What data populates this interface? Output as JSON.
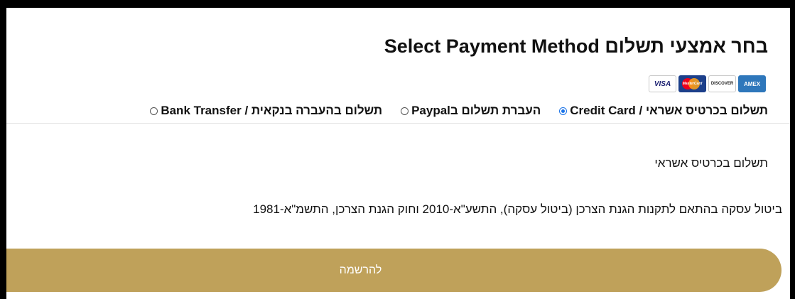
{
  "title": "בחר אמצעי תשלום Select Payment Method",
  "card_logos": [
    {
      "label": "VISA",
      "icon": "visa-logo"
    },
    {
      "label": "MasterCard",
      "icon": "mastercard-logo"
    },
    {
      "label": "DISCOVER",
      "icon": "discover-logo"
    },
    {
      "label": "AMEX",
      "icon": "amex-logo"
    }
  ],
  "payment_methods": [
    {
      "label": "תשלום בכרטיס אשראי / Credit Card",
      "selected": true
    },
    {
      "label": "העברת תשלום בPaypal",
      "selected": false
    },
    {
      "label": "תשלום בהעברה בנקאית / Bank Transfer",
      "selected": false
    }
  ],
  "selected_method_label": "תשלום בכרטיס אשראי",
  "cancellation_note": "ביטול עסקה בהתאם לתקנות הגנת הצרכן (ביטול עסקה), התשע\"א-2010 וחוק הגנת הצרכן, התשמ\"א-1981",
  "register_button_label": "להרשמה",
  "colors": {
    "button": "#bfa15a",
    "radio_selected": "#1a73e8",
    "frame": "#000000"
  }
}
